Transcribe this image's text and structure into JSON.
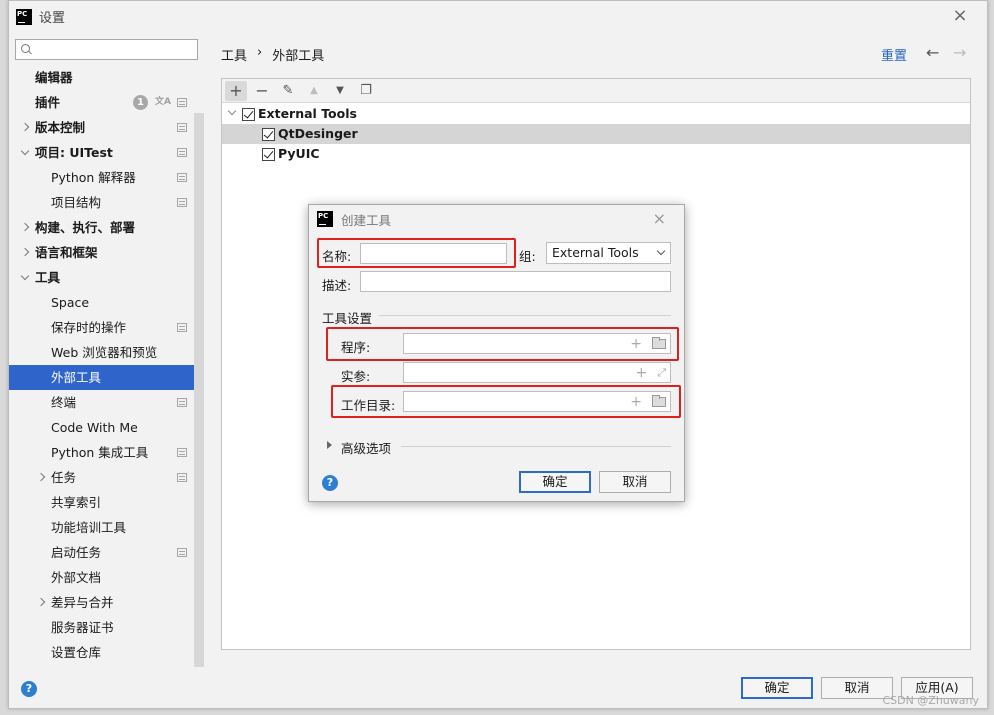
{
  "window": {
    "title": "设置",
    "app_icon": "pycharm-logo",
    "logo_text": "PC"
  },
  "sidebar": {
    "search_placeholder": "",
    "items": [
      {
        "label": "编辑器",
        "level": 0,
        "bold": true
      },
      {
        "label": "插件",
        "level": 0,
        "bold": true,
        "badge": "1"
      },
      {
        "label": "版本控制",
        "level": 0,
        "bold": true,
        "expander": "right"
      },
      {
        "label": "项目: UITest",
        "level": 0,
        "bold": true,
        "expander": "down"
      },
      {
        "label": "Python 解释器",
        "level": 1
      },
      {
        "label": "项目结构",
        "level": 1
      },
      {
        "label": "构建、执行、部署",
        "level": 0,
        "bold": true,
        "expander": "right"
      },
      {
        "label": "语言和框架",
        "level": 0,
        "bold": true,
        "expander": "right"
      },
      {
        "label": "工具",
        "level": 0,
        "bold": true,
        "expander": "down"
      },
      {
        "label": "Space",
        "level": 1
      },
      {
        "label": "保存时的操作",
        "level": 1
      },
      {
        "label": "Web 浏览器和预览",
        "level": 1
      },
      {
        "label": "外部工具",
        "level": 1,
        "selected": true
      },
      {
        "label": "终端",
        "level": 1
      },
      {
        "label": "Code With Me",
        "level": 1
      },
      {
        "label": "Python 集成工具",
        "level": 1
      },
      {
        "label": "任务",
        "level": 1,
        "expander": "right"
      },
      {
        "label": "共享索引",
        "level": 1
      },
      {
        "label": "功能培训工具",
        "level": 1
      },
      {
        "label": "启动任务",
        "level": 1
      },
      {
        "label": "外部文档",
        "level": 1
      },
      {
        "label": "差异与合并",
        "level": 1,
        "expander": "right"
      },
      {
        "label": "服务器证书",
        "level": 1
      },
      {
        "label": "设置仓库",
        "level": 1
      }
    ]
  },
  "header": {
    "breadcrumb_parent": "工具",
    "breadcrumb_sep": "›",
    "breadcrumb_current": "外部工具",
    "reset_label": "重置",
    "back_arrow": "←",
    "forward_arrow": "→"
  },
  "toolbar": {
    "add": "+",
    "remove": "−",
    "edit": "✎",
    "move_up": "▲",
    "move_down": "▼",
    "copy": "❐"
  },
  "tools_tree": {
    "group": "External Tools",
    "children": [
      "QtDesinger",
      "PyUIC"
    ]
  },
  "dialog": {
    "title": "创建工具",
    "name_label": "名称:",
    "name_value": "",
    "group_label": "组:",
    "group_value": "External Tools",
    "description_label": "描述:",
    "description_value": "",
    "tool_settings_label": "工具设置",
    "program_label": "程序:",
    "program_value": "",
    "arguments_label": "实参:",
    "arguments_value": "",
    "workdir_label": "工作目录:",
    "workdir_value": "",
    "advanced_label": "高级选项",
    "ok_label": "确定",
    "cancel_label": "取消",
    "help": "?",
    "close": "×",
    "plus": "+",
    "expand": "⤢"
  },
  "footer": {
    "help": "?",
    "ok_label": "确定",
    "cancel_label": "取消",
    "apply_label": "应用(A)",
    "watermark": "CSDN @Zhuwany"
  },
  "colors": {
    "selection": "#2f65ca",
    "link": "#2466c4",
    "highlight_box": "#e0201c"
  }
}
